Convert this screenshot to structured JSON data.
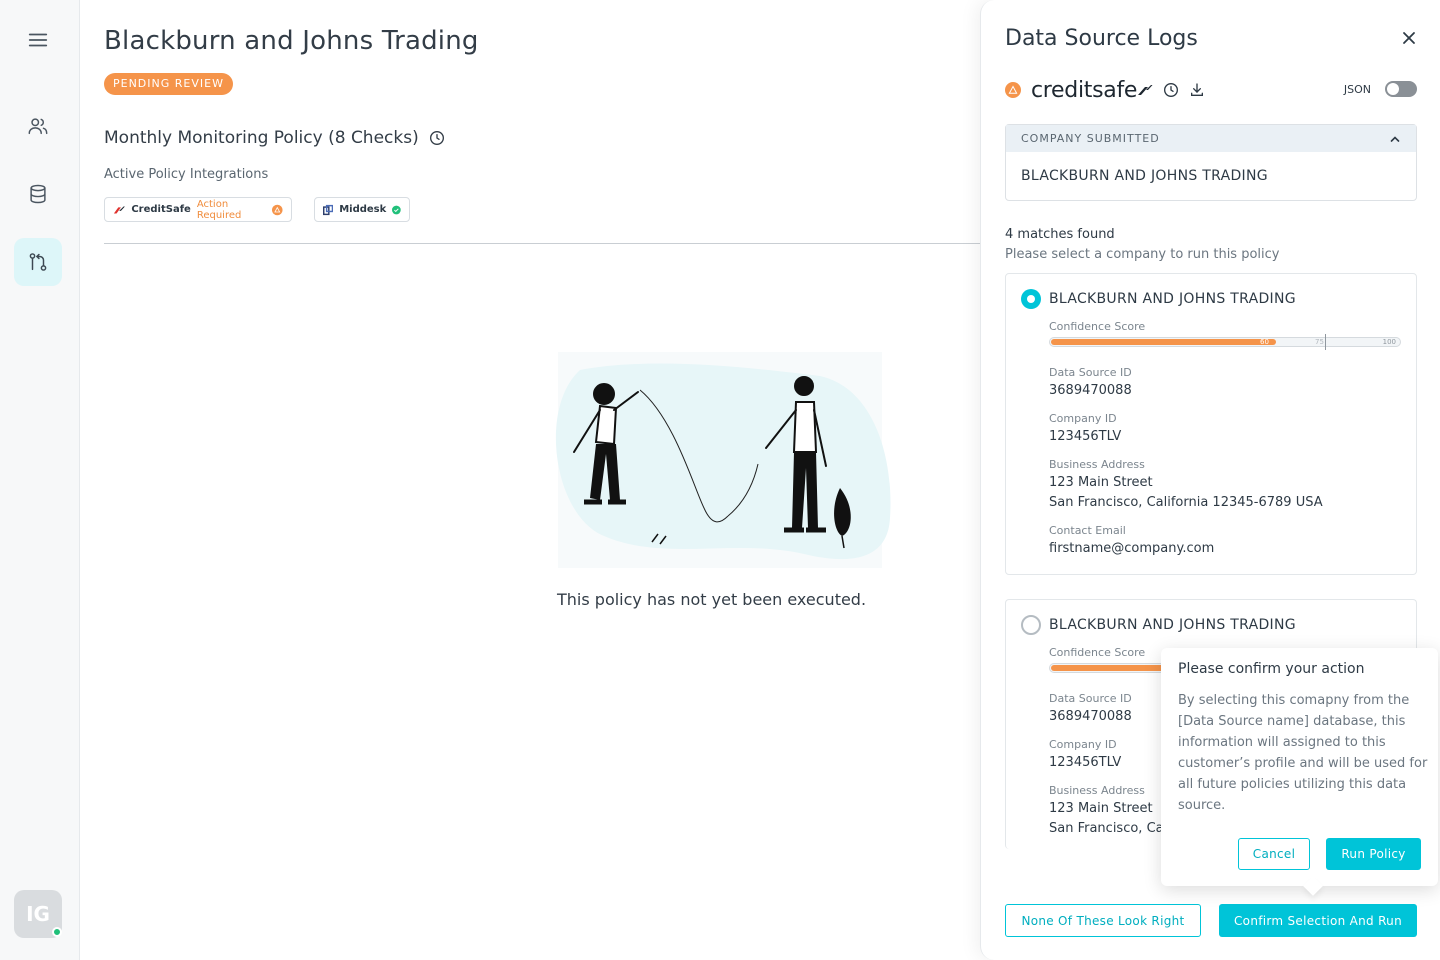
{
  "sidebar": {
    "items": [
      {
        "icon": "menu-icon"
      },
      {
        "icon": "users-icon"
      },
      {
        "icon": "database-icon"
      },
      {
        "icon": "git-compare-icon",
        "active": true
      }
    ],
    "avatar_initials": "IG",
    "status": "online"
  },
  "main": {
    "title": "Blackburn and Johns Trading",
    "status_badge": "PENDING REVIEW",
    "policy_title": "Monthly Monitoring Policy (8 Checks)",
    "integrations_label": "Active Policy Integrations",
    "integrations": [
      {
        "name": "CreditSafe",
        "status": "Action Required",
        "status_color": "#f08c3c"
      },
      {
        "name": "Middesk",
        "status_color": "#20c07a"
      }
    ],
    "empty_message": "This policy has not yet been executed."
  },
  "panel": {
    "title": "Data Source Logs",
    "source_name": "creditsafe",
    "json_label": "JSON",
    "json_enabled": false,
    "submitted": {
      "header": "COMPANY SUBMITTED",
      "value": "BLACKBURN AND JOHNS TRADING"
    },
    "matches_count_text": "4 matches found",
    "matches_hint": "Please select a company to run this policy",
    "matches": [
      {
        "name": "BLACKBURN AND JOHNS TRADING",
        "selected": true,
        "confidence_label": "Confidence Score",
        "score": 60,
        "threshold": 75,
        "max": 100,
        "score_text": "60",
        "threshold_text": "75",
        "max_text": "100",
        "data_source_id_label": "Data Source ID",
        "data_source_id": "3689470088",
        "company_id_label": "Company ID",
        "company_id": "123456TLV",
        "address_label": "Business Address",
        "address_line1": "123 Main Street",
        "address_line2": "San Francisco, California 12345-6789 USA",
        "email_label": "Contact Email",
        "email": "firstname@company.com"
      },
      {
        "name": "BLACKBURN AND JOHNS TRADING",
        "selected": false,
        "confidence_label": "Confidence Score",
        "data_source_id_label": "Data Source ID",
        "data_source_id": "3689470088",
        "company_id_label": "Company ID",
        "company_id": "123456TLV",
        "address_label": "Business Address",
        "address_line1": "123 Main Street",
        "address_line2": "San Francisco, Cal"
      }
    ],
    "none_button": "None Of These Look Right",
    "confirm_button": "Confirm Selection And Run"
  },
  "confirm_popover": {
    "title": "Please confirm your action",
    "body": "By selecting this comapny from the [Data Source name] database, this information will assigned to this customer’s profile and will be used for all future policies utilizing this data source.",
    "cancel_label": "Cancel",
    "run_label": "Run Policy"
  },
  "colors": {
    "accent": "#00c4d8",
    "warning": "#f5944a",
    "success": "#20c07a"
  }
}
